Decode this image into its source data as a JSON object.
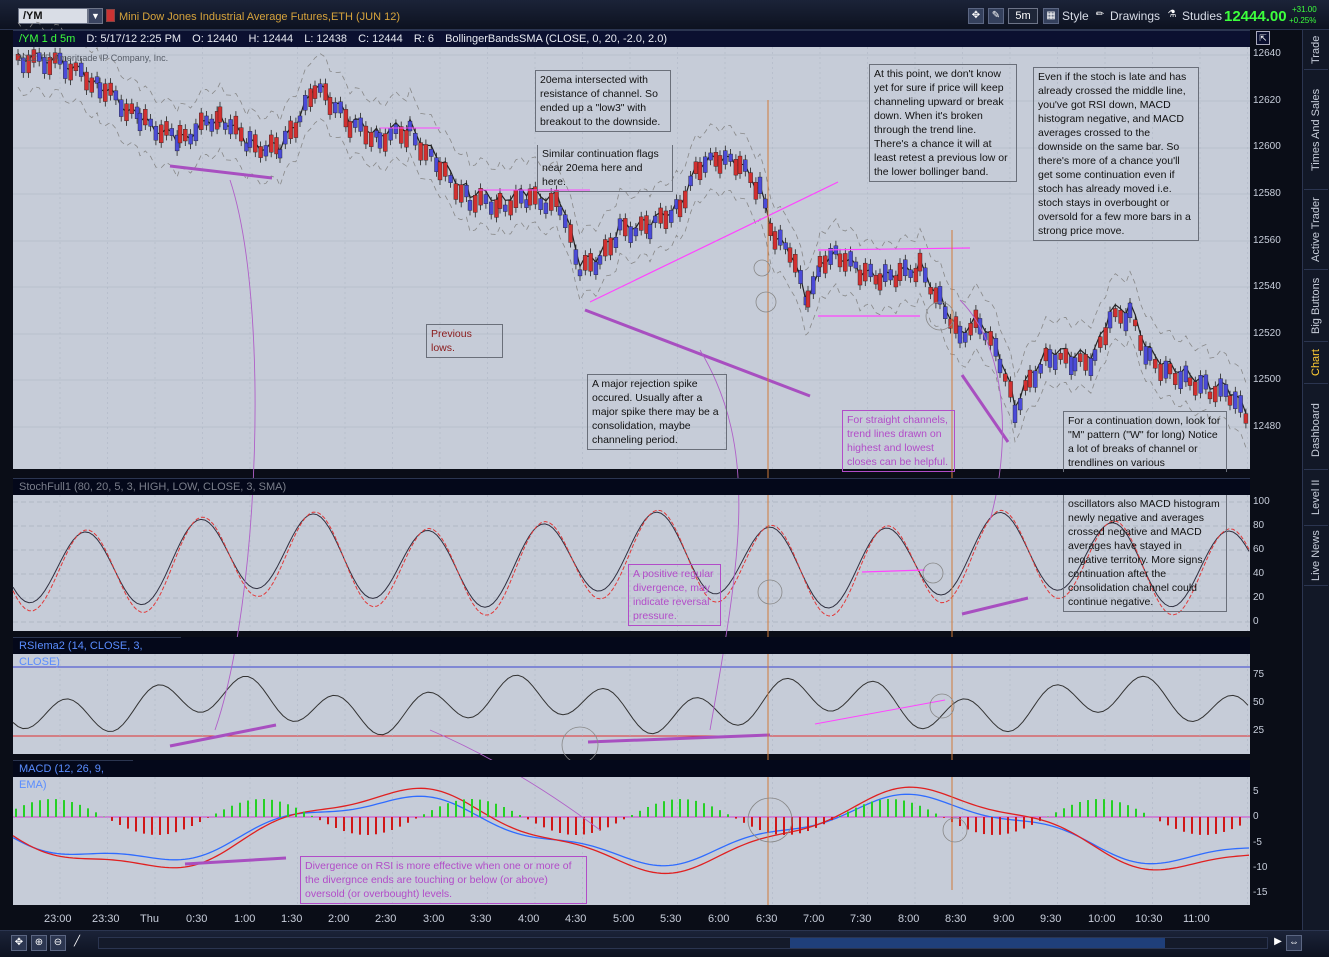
{
  "window": {
    "symbol": "/YM",
    "instrument": "Mini Dow Jones Industrial Average Futures,ETH (JUN 12)",
    "timeframe_button": "5m",
    "style_label": "Style",
    "drawings_label": "Drawings",
    "studies_label": "Studies",
    "last_price": "12444.00",
    "change_abs": "+31.00",
    "change_pct": "+0.25%"
  },
  "side_tabs": [
    "Trade",
    "Times And Sales",
    "Active Trader",
    "Big Buttons",
    "Chart",
    "Level II",
    "Live News",
    "Dashboard"
  ],
  "price_panel": {
    "symbol_label": "/YM 1 d 5m",
    "date": "D: 5/17/12 2:25 PM",
    "open": "O: 12440",
    "high": "H: 12444",
    "low": "L: 12438",
    "close": "C: 12444",
    "range": "R: 6",
    "study": "BollingerBandsSMA (CLOSE, 0, 20, -2.0, 2.0)",
    "watermark": "2012 TD Ameritrade IP Company, Inc.",
    "y_ticks": [
      "12640",
      "12620",
      "12600",
      "12580",
      "12560",
      "12540",
      "12520",
      "12500",
      "12480"
    ]
  },
  "stoch_panel": {
    "header": "StochFull1 (80, 20, 5, 3, HIGH, LOW, CLOSE, 3, SMA)",
    "y_ticks": [
      "100",
      "80",
      "60",
      "40",
      "20",
      "0"
    ]
  },
  "rsi_panel": {
    "header": "RSIema2 (14, CLOSE, 3, CLOSE)",
    "y_ticks": [
      "75",
      "50",
      "25"
    ]
  },
  "macd_panel": {
    "header": "MACD (12, 26, 9, EMA)",
    "y_ticks": [
      "5",
      "0",
      "-5",
      "-10",
      "-15"
    ]
  },
  "time_axis": [
    "23:00",
    "23:30",
    "Thu",
    "0:30",
    "1:00",
    "1:30",
    "2:00",
    "2:30",
    "3:00",
    "3:30",
    "4:00",
    "4:30",
    "5:00",
    "5:30",
    "6:00",
    "6:30",
    "7:00",
    "7:30",
    "8:00",
    "8:30",
    "9:00",
    "9:30",
    "10:00",
    "10:30",
    "11:00"
  ],
  "notes": {
    "ema20": "20ema intersected with resistance of channel. So ended up a \"low3\" with breakout to the downside.",
    "continuation_flags": "Similar continuation flags near 20ema here and here.",
    "previous_lows": "Previous lows.",
    "rejection_spike": "A major rejection spike occured. Usually after a major spike there may be a consolidation, maybe channeling period.",
    "uncertain": "At this point, we don't know yet for sure if price will keep channeling upward or break down. When it's broken through the trend line. There's a chance it will at least retest a previous low or the lower bollinger band.",
    "stoch_late": "Even if the stoch is late and has already crossed the middle line, you've got RSI down, MACD histogram negative, and MACD averages crossed to the downside on the same bar. So there's more of a chance you'll get some continuation even if stoch has already moved i.e. stoch stays in overbought or oversold for a few more bars in a strong price move.",
    "straight_channels": "For straight channels, trend lines drawn on highest and lowest closes can be helpful.",
    "continuation_down": "For a continuation down, look for \"M\" pattern (\"W\" for long) Notice a lot of breaks of channel or trendlines on various",
    "oscillators": "oscillators also MACD histogram newly negative and averages crossed negative and MACD averages have stayed in negative territory. More signs continuation after the consolidation channel could continue negative.",
    "positive_divergence": "A positive regular divergence, may indicate reversal pressure.",
    "rsi_divergence": "Divergence on RSI is more effective when one or more of the divergnce ends are touching or below (or above) oversold (or overbought) levels."
  },
  "colors": {
    "chart_bg": "#c6ccd8",
    "up_candle": "#4b4bd8",
    "down_candle": "#d23030",
    "stoch_line": "#303040",
    "stoch_signal": "#e23a3a",
    "macd_line": "#2f6cff",
    "macd_signal": "#e02020",
    "hist_up": "#26d026",
    "hist_down": "#d01818",
    "annotation_purple": "#a84fc0",
    "annotation_magenta": "#ff44ff",
    "annotation_orange": "#d07a3a"
  }
}
